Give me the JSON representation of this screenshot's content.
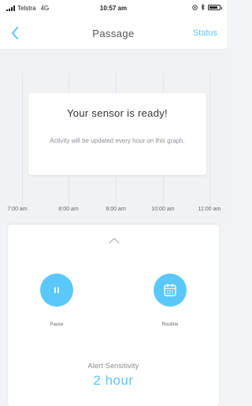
{
  "status_bar": {
    "carrier": "Telstra",
    "network": "4G",
    "time": "10:57 am",
    "icons": [
      "signal-bars-icon",
      "location-icon",
      "bluetooth-icon",
      "battery-icon"
    ],
    "battery_level": 0.85
  },
  "nav": {
    "back_icon": "chevron-left-icon",
    "title": "Passage",
    "status_label": "Status"
  },
  "graph": {
    "time_labels": [
      "7:00 am",
      "8:00 am",
      "9:00 am",
      "10:00 am",
      "11:00 am"
    ]
  },
  "ready_card": {
    "heading": "Your sensor is ready!",
    "body": "Activity will be updated every hour on this graph."
  },
  "panel": {
    "collapse_icon": "chevron-up-icon",
    "pause_label": "Pause",
    "pause_icon": "pause-icon",
    "routine_label": "Routine",
    "routine_icon": "calendar-icon",
    "sensitivity_label": "Alert Sensitivity",
    "sensitivity_value": "2 hour"
  },
  "colors": {
    "accent": "#5ac8fa",
    "background": "#f2f3f5",
    "card": "#ffffff"
  }
}
